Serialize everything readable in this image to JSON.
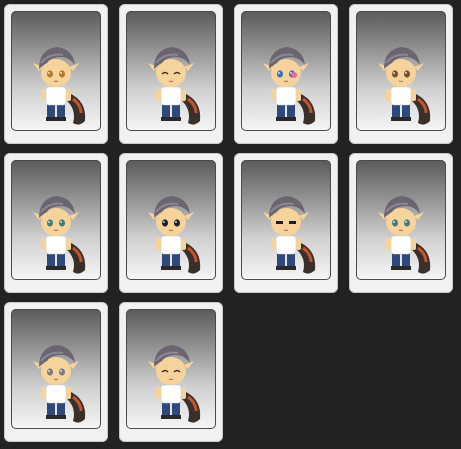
{
  "cards": [
    {
      "variant": "face-1",
      "eyes": "amber",
      "expression": "neutral"
    },
    {
      "variant": "face-2",
      "eyes": "closed",
      "expression": "smile"
    },
    {
      "variant": "face-3",
      "eyes": "blue-pink",
      "expression": "wink"
    },
    {
      "variant": "face-4",
      "eyes": "brown",
      "expression": "calm"
    },
    {
      "variant": "face-5",
      "eyes": "teal",
      "expression": "neutral"
    },
    {
      "variant": "face-6",
      "eyes": "dark",
      "expression": "wide"
    },
    {
      "variant": "face-7",
      "eyes": "dark",
      "expression": "stern"
    },
    {
      "variant": "face-8",
      "eyes": "teal",
      "expression": "neutral"
    },
    {
      "variant": "face-9",
      "eyes": "gray",
      "expression": "sleepy"
    },
    {
      "variant": "face-10",
      "eyes": "closed",
      "expression": "smirk"
    }
  ],
  "colors": {
    "background": "#222222",
    "card": "#f1f1f1",
    "hair": "#6b6570",
    "skin": "#f6d39b",
    "shirt": "#ffffff",
    "pants": "#2f4a7a",
    "tail": "#3a302a",
    "accent": "#c2542e"
  }
}
